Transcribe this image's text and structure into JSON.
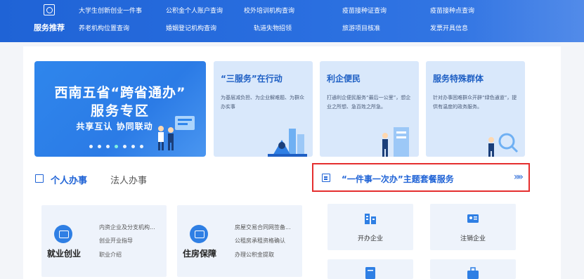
{
  "topbar": {
    "service_label": "服务推荐",
    "links_row1": [
      "大学生创新创业一件事",
      "公积金个人账户查询",
      "校外培训机构查询",
      "疫苗接种证查询",
      "疫苗接种点查询"
    ],
    "links_row2": [
      "养老机构位置查询",
      "婚姻登记机构查询",
      "轨道失物招领",
      "旅游项目核准",
      "发票开具信息"
    ]
  },
  "hero": {
    "title_line1": "西南五省“跨省通办”",
    "title_line2": "服务专区",
    "subtitle": "共享互认  协同联动",
    "slide_count": 7,
    "active_slide": 3
  },
  "feature_cards": [
    {
      "title": "“三服务”在行动",
      "desc": "为基层减负担、为企业解难题、为群众办实事"
    },
    {
      "title": "利企便民",
      "desc": "打通利企便民服务“最后一公里”，想企业之所想、急百姓之所急。"
    },
    {
      "title": "服务特殊群体",
      "desc": "针对办事困难群众开辟“绿色通道”，提供有温度的政务服务。"
    }
  ],
  "tabs": {
    "personal": "个人办事",
    "legal": "法人办事"
  },
  "theme": {
    "title": "“一件事一次办”主题套餐服务",
    "more": "»»"
  },
  "personal_blocks": [
    {
      "name": "就业创业",
      "links": [
        "内资企业及分支机构...",
        "创业开业指导",
        "职业介绍"
      ]
    },
    {
      "name": "住房保障",
      "links": [
        "房屋交易合同网签备...",
        "公租房承租资格确认",
        "办理公积金提取"
      ]
    }
  ],
  "theme_tiles": [
    {
      "label": "开办企业"
    },
    {
      "label": "注销企业"
    },
    {
      "label": ""
    },
    {
      "label": ""
    }
  ],
  "colors": {
    "brand_blue": "#1f63d6",
    "highlight_red": "#e52e2e",
    "card_bg": "#d9e8fb"
  }
}
